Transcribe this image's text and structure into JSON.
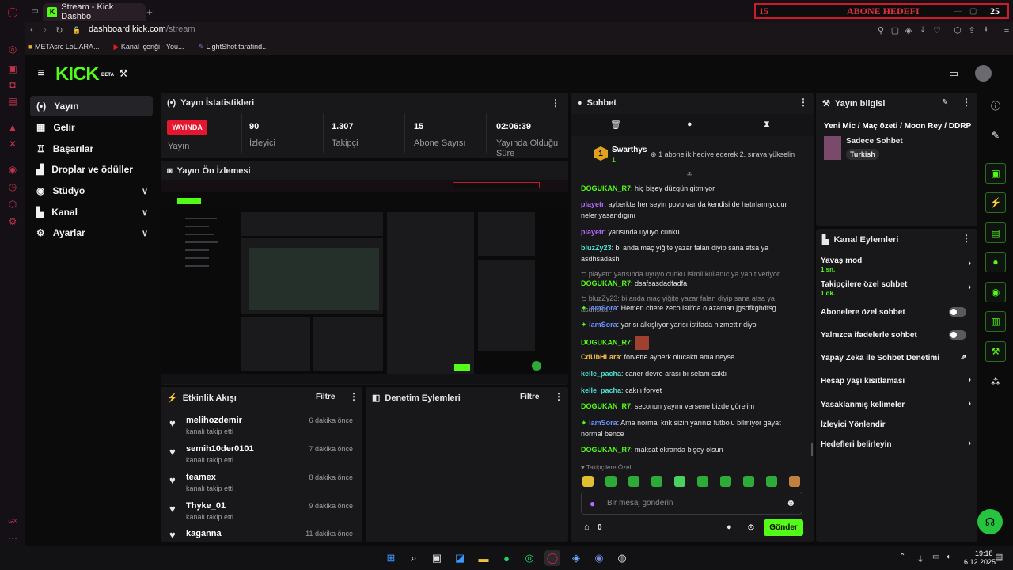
{
  "browser": {
    "tab_title": "Stream - Kick Dashbo",
    "new_tab": "+",
    "url_host": "dashboard.kick.com",
    "url_path": "/stream",
    "bookmarks": [
      "METAsrc LoL ARA...",
      "Kanal içeriği - You...",
      "LightShot tarafind..."
    ]
  },
  "overlay": {
    "count_left": "15",
    "label": "ABONE HEDEFI",
    "count_right": "25"
  },
  "header": {
    "logo": "KICK",
    "beta": "BETA"
  },
  "sidebar": {
    "items": [
      {
        "label": "Yayın",
        "icon": "broadcast-icon",
        "active": true
      },
      {
        "label": "Gelir",
        "icon": "revenue-icon"
      },
      {
        "label": "Başarılar",
        "icon": "trophy-icon"
      },
      {
        "label": "Droplar ve ödüller",
        "icon": "drops-icon"
      },
      {
        "label": "Stüdyo",
        "icon": "studio-icon",
        "expandable": true
      },
      {
        "label": "Kanal",
        "icon": "channel-icon",
        "expandable": true
      },
      {
        "label": "Ayarlar",
        "icon": "settings-icon",
        "expandable": true
      }
    ]
  },
  "stats": {
    "title": "Yayın İstatistikleri",
    "live_badge": "YAYINDA",
    "live_label": "Yayın",
    "items": [
      {
        "value": "90",
        "label": "İzleyici"
      },
      {
        "value": "1.307",
        "label": "Takipçi"
      },
      {
        "value": "15",
        "label": "Abone Sayısı"
      },
      {
        "value": "02:06:39",
        "label": "Yayında Olduğu Süre"
      }
    ]
  },
  "preview": {
    "title": "Yayın Ön İzlemesi"
  },
  "activity": {
    "title": "Etkinlik Akışı",
    "filter": "Filtre",
    "items": [
      {
        "name": "melihozdemir",
        "sub": "kanalı takip etti",
        "time": "6 dakika önce"
      },
      {
        "name": "semih10der0101",
        "sub": "kanalı takip etti",
        "time": "7 dakika önce"
      },
      {
        "name": "teamex",
        "sub": "kanalı takip etti",
        "time": "8 dakika önce"
      },
      {
        "name": "Thyke_01",
        "sub": "kanalı takip etti",
        "time": "9 dakika önce"
      },
      {
        "name": "kaganna",
        "sub": "",
        "time": "11 dakika önce"
      }
    ]
  },
  "moderation": {
    "title": "Denetim Eylemleri",
    "filter": "Filtre"
  },
  "chat": {
    "title": "Sohbet",
    "pinned_user": "Swarthys",
    "pinned_count": "1",
    "pinned_rank": "1",
    "pinned_msg": "1 abonelik hediye ederek 2. sıraya yükselin",
    "messages": [
      {
        "user": "DOGUKAN_R7",
        "color": "g",
        "text": "hiç bişey düzgün gitmiyor"
      },
      {
        "user": "playetr",
        "color": "p",
        "text": "ayberkte her seyin povu var da kendisi de hatırlamıyodur neler yasandıgını"
      },
      {
        "user": "playetr",
        "color": "p",
        "text": "yarısında uyuyo cunku"
      },
      {
        "user": "bluzZy23",
        "color": "c",
        "text": "bi anda maç yiğite yazar falan diyip sana atsa ya asdhsadash"
      },
      {
        "reply": "playetr: yarısında uyuyo cunku isimli kullanıcıya yanıt veriyor",
        "user": "DOGUKAN_R7",
        "color": "g",
        "text": "dsafsasdadfadfa"
      },
      {
        "reply": "bluzZy23: bi anda maç yiğite yazar falan diyip sana atsa ya asdhsad...",
        "user": "iamSora",
        "color": "b",
        "text": "Hemen chete zeco istifda o azaman jgsdfkghdfsg"
      },
      {
        "user": "iamSora",
        "color": "b",
        "text": "yarısı alkışlıyor yarısı istifada hizmettir diyo"
      },
      {
        "user": "DOGUKAN_R7",
        "color": "g",
        "text": ""
      },
      {
        "user": "CdUbHLara",
        "color": "y",
        "text": "forvette ayberk olucaktı ama neyse"
      },
      {
        "user": "kelle_pacha",
        "color": "c",
        "text": "caner devre arası bı selam caktı"
      },
      {
        "user": "kelle_pacha",
        "color": "c",
        "text": "cakılı forvet"
      },
      {
        "user": "DOGUKAN_R7",
        "color": "g",
        "text": "seconun yayını versene bizde görelim"
      },
      {
        "user": "iamSora",
        "color": "b",
        "text": "Ama normal knk sizin yarınız futbolu bilmiyor gayat normal bence"
      },
      {
        "user": "DOGUKAN_R7",
        "color": "g",
        "text": "maksat ekranda bişey olsun"
      }
    ],
    "followers_only": "Takipçilere Özel",
    "input_placeholder": "Bir mesaj gönderin",
    "points": "0",
    "send": "Gönder"
  },
  "stream_info": {
    "title": "Yayın bilgisi",
    "stream_title": "Yeni Mic / Maç özeti / Moon Rey / DDRP",
    "category": "Sadece Sohbet",
    "tag": "Turkish"
  },
  "channel_actions": {
    "title": "Kanal Eylemleri",
    "items": [
      {
        "label": "Yavaş mod",
        "sub": "1 sn.",
        "control": "chevron"
      },
      {
        "label": "Takipçilere özel sohbet",
        "sub": "1 dk.",
        "control": "chevron"
      },
      {
        "label": "Abonelere özel sohbet",
        "control": "toggle"
      },
      {
        "label": "Yalnızca ifadelerle sohbet",
        "control": "toggle"
      },
      {
        "label": "Yapay Zeka ile Sohbet Denetimi",
        "control": "external"
      },
      {
        "label": "Hesap yaşı kısıtlaması",
        "control": "chevron"
      },
      {
        "label": "Yasaklanmış kelimeler",
        "control": "chevron"
      },
      {
        "label": "İzleyici Yönlendir",
        "control": "none"
      },
      {
        "label": "Hedefleri belirleyin",
        "control": "chevron"
      }
    ]
  },
  "taskbar": {
    "time": "19:18",
    "date": "6.12.2025"
  },
  "colors": {
    "accent": "#53fc18",
    "live": "#e5162d",
    "panel": "#18181b",
    "bg": "#0b0b0c"
  }
}
